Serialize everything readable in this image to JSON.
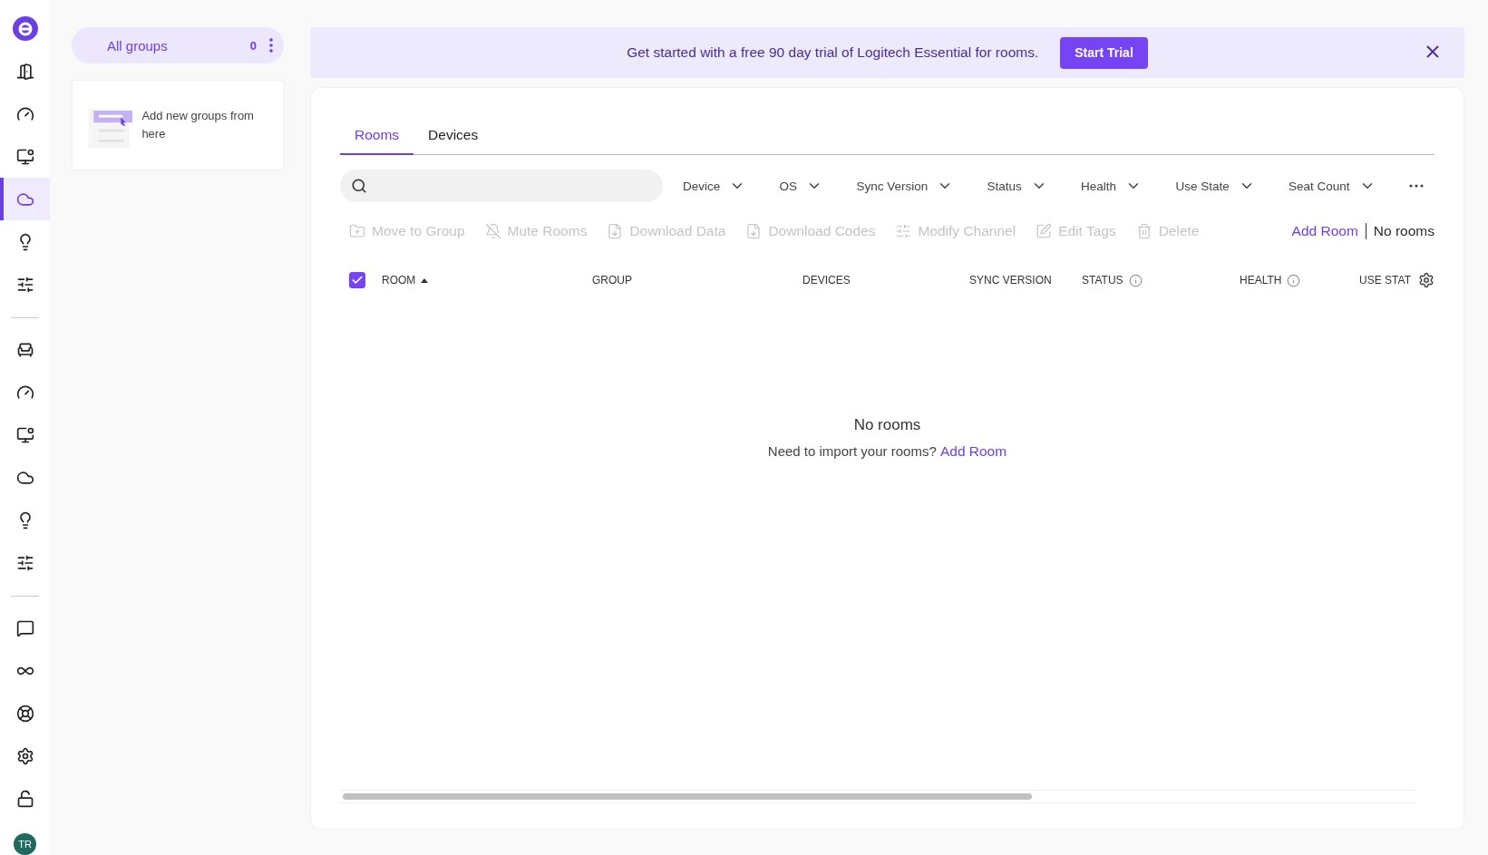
{
  "sidebar": {
    "top_items": [
      {
        "selected": false
      },
      {
        "selected": false
      },
      {
        "selected": false
      },
      {
        "selected": true
      },
      {
        "selected": false
      },
      {
        "selected": false
      }
    ],
    "middle_items": [
      {
        "selected": false
      },
      {
        "selected": false
      },
      {
        "selected": false
      },
      {
        "selected": false
      },
      {
        "selected": false
      },
      {
        "selected": false
      }
    ],
    "bottom_items": [
      {
        "selected": false
      },
      {
        "selected": false
      },
      {
        "selected": false
      },
      {
        "selected": false
      },
      {
        "selected": false
      }
    ],
    "avatar": "TR"
  },
  "groups": {
    "title": "All groups",
    "count": "0",
    "hint": "Add new groups from here"
  },
  "banner": {
    "message": "Get started with a free 90 day trial of Logitech Essential for rooms.",
    "button": "Start Trial"
  },
  "tabs": [
    {
      "label": "Rooms",
      "selected": true
    },
    {
      "label": "Devices",
      "selected": false
    }
  ],
  "filters": [
    "Device",
    "OS",
    "Sync Version",
    "Status",
    "Health",
    "Use State",
    "Seat Count"
  ],
  "actions": [
    {
      "label": "Move to Group",
      "disabled": true
    },
    {
      "label": "Mute Rooms",
      "disabled": true
    },
    {
      "label": "Download Data",
      "disabled": true
    },
    {
      "label": "Download Codes",
      "disabled": true
    },
    {
      "label": "Modify Channel",
      "disabled": true
    },
    {
      "label": "Edit Tags",
      "disabled": true
    },
    {
      "label": "Delete",
      "disabled": true
    }
  ],
  "add_room": "Add Room",
  "room_count": "No rooms",
  "table": {
    "select_all_checked": true,
    "columns": [
      {
        "label": "ROOM",
        "sorted": true,
        "info": false
      },
      {
        "label": "GROUP",
        "sorted": false,
        "info": false
      },
      {
        "label": "DEVICES",
        "sorted": false,
        "info": false
      },
      {
        "label": "SYNC VERSION",
        "sorted": false,
        "info": false
      },
      {
        "label": "STATUS",
        "sorted": false,
        "info": true
      },
      {
        "label": "HEALTH",
        "sorted": false,
        "info": true
      },
      {
        "label": "USE STAT",
        "sorted": false,
        "info": false
      }
    ]
  },
  "empty": {
    "title": "No rooms",
    "text": "Need to import your rooms?",
    "link": "Add Room"
  }
}
